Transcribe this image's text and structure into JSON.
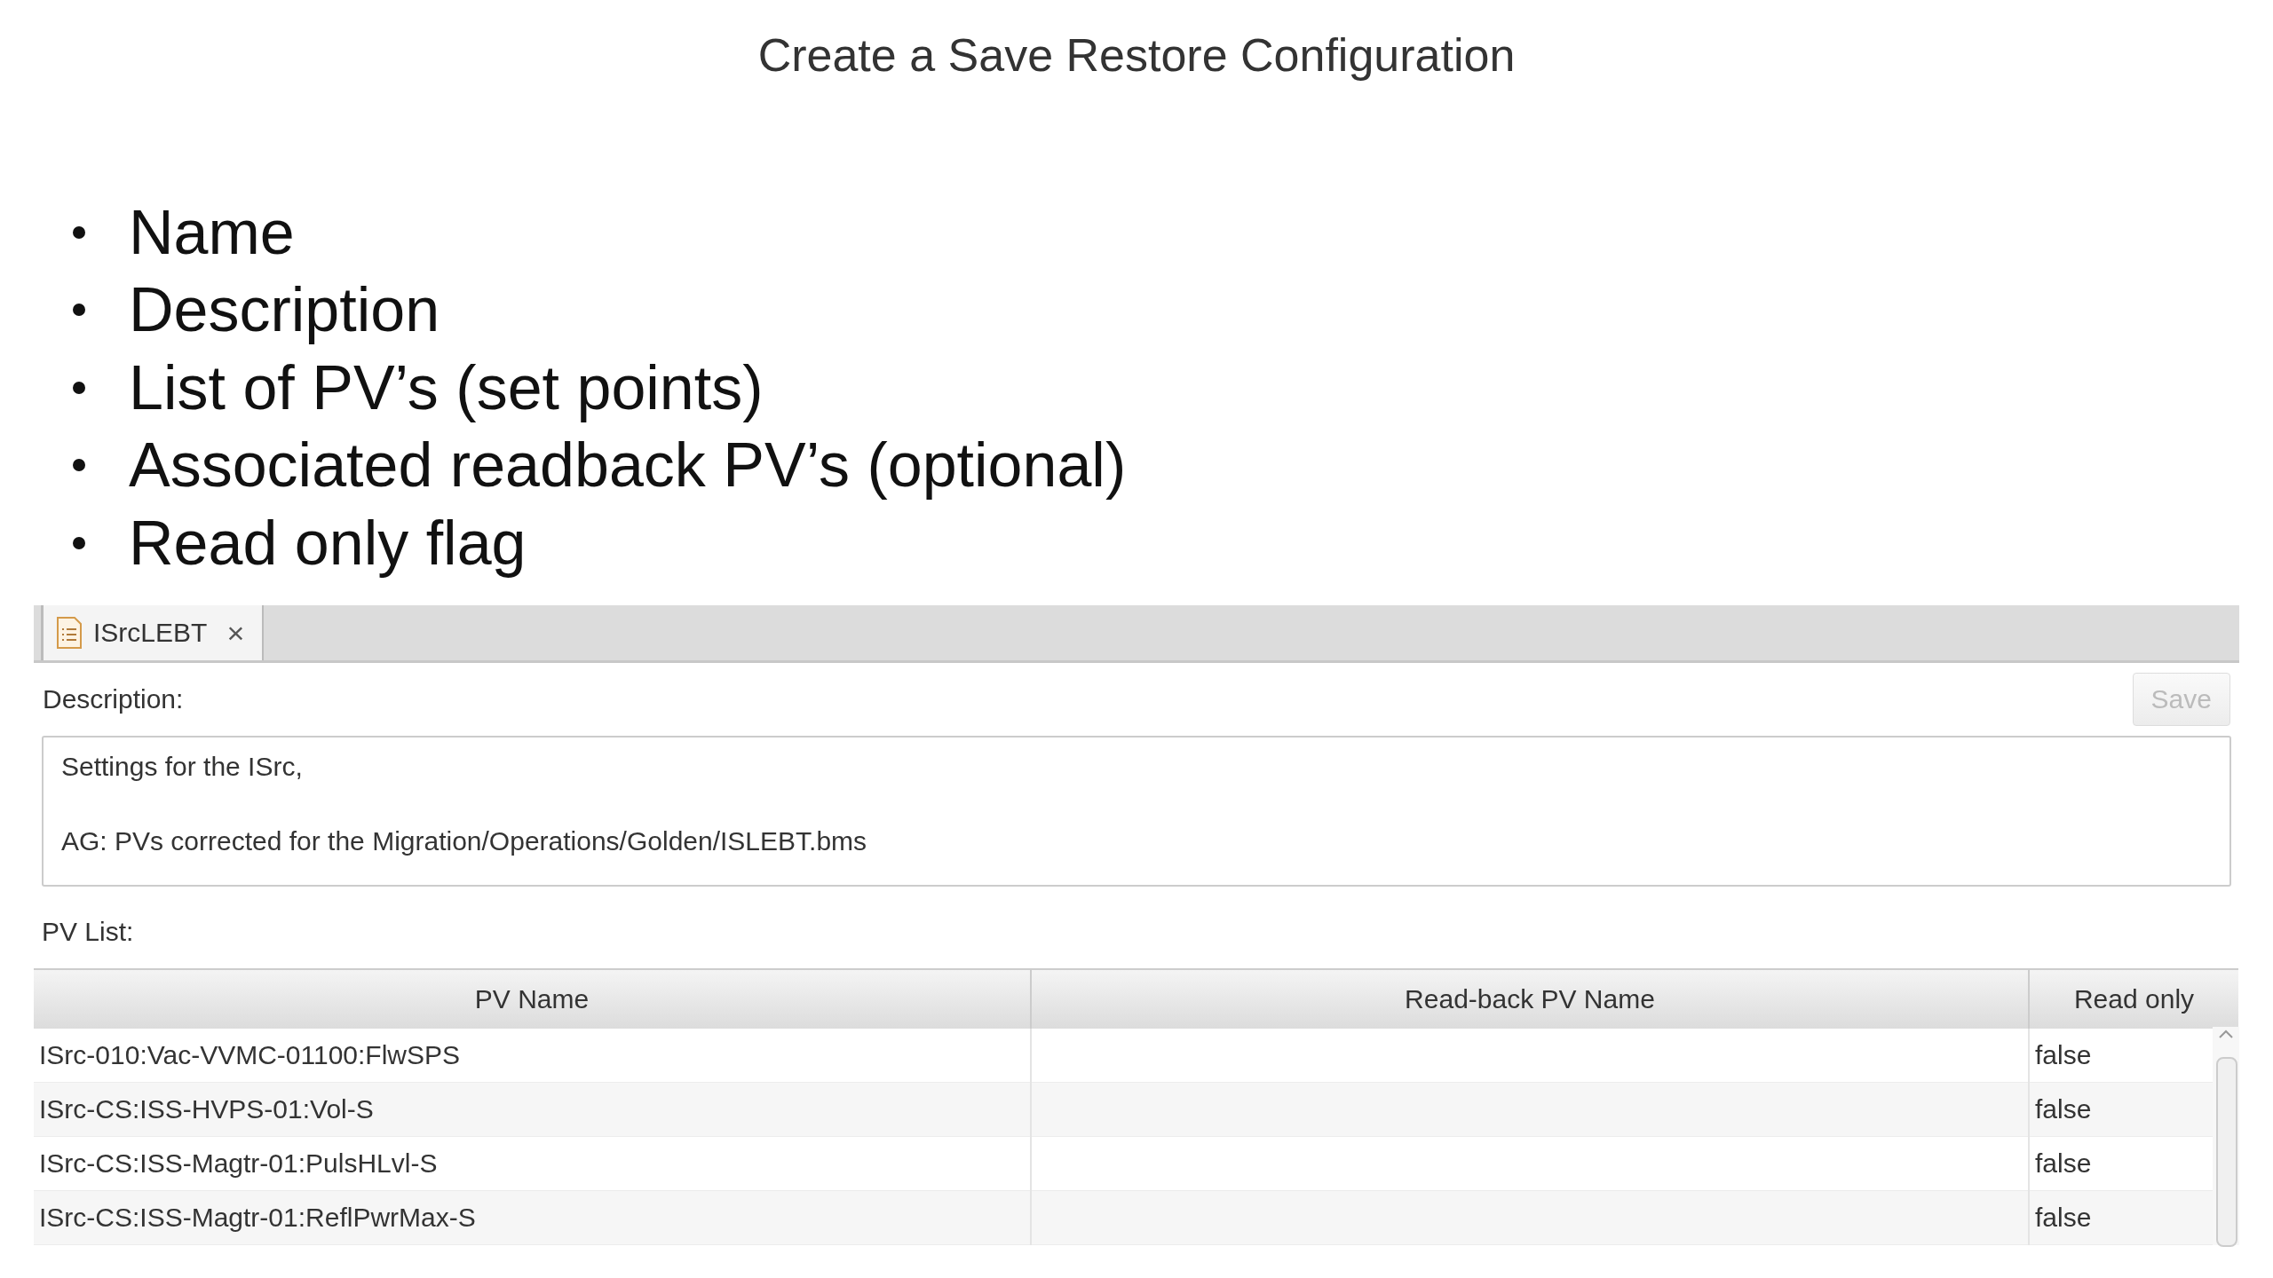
{
  "title": "Create a Save Restore Configuration",
  "bullets": [
    "Name",
    "Description",
    "List of PV’s (set points)",
    "Associated readback PV’s (optional)",
    "Read only flag"
  ],
  "editor": {
    "tabs": [
      {
        "label": "ISrcLEBT",
        "close": "×",
        "selected": true
      }
    ],
    "description_label": "Description:",
    "save_button": {
      "label": "Save",
      "disabled": true
    },
    "description": {
      "value": "Settings for the ISrc,\n\nAG: PVs corrected for the Migration/Operations/Golden/ISLEBT.bms"
    },
    "pv_list_label": "PV List:",
    "table": {
      "columns": [
        "PV Name",
        "Read-back PV Name",
        "Read only"
      ],
      "rows": [
        {
          "pv_name": "ISrc-010:Vac-VVMC-01100:FlwSPS",
          "readback": "",
          "read_only": "false"
        },
        {
          "pv_name": "ISrc-CS:ISS-HVPS-01:Vol-S",
          "readback": "",
          "read_only": "false"
        },
        {
          "pv_name": "ISrc-CS:ISS-Magtr-01:PulsHLvl-S",
          "readback": "",
          "read_only": "false"
        },
        {
          "pv_name": "ISrc-CS:ISS-Magtr-01:ReflPwrMax-S",
          "readback": "",
          "read_only": "false"
        }
      ]
    }
  }
}
